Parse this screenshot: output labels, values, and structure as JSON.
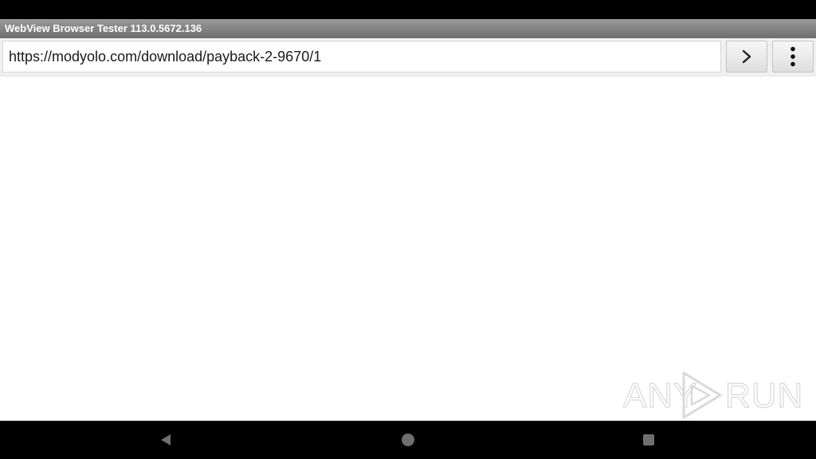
{
  "window": {
    "title": "WebView Browser Tester 113.0.5672.136"
  },
  "toolbar": {
    "url_value": "https://modyolo.com/download/payback-2-9670/1",
    "go_icon": "chevron-right-icon",
    "menu_icon": "more-vert-icon"
  },
  "watermark": {
    "left_text": "ANY",
    "right_text": "RUN",
    "logo_icon": "play-triangle-icon"
  },
  "nav": {
    "back_icon": "back-triangle-icon",
    "home_icon": "home-circle-icon",
    "recents_icon": "recents-square-icon"
  },
  "colors": {
    "status_bar": "#000000",
    "title_bar": "#8a8a8a",
    "toolbar": "#f0f0f0",
    "nav_icon": "#6f6f6f"
  }
}
